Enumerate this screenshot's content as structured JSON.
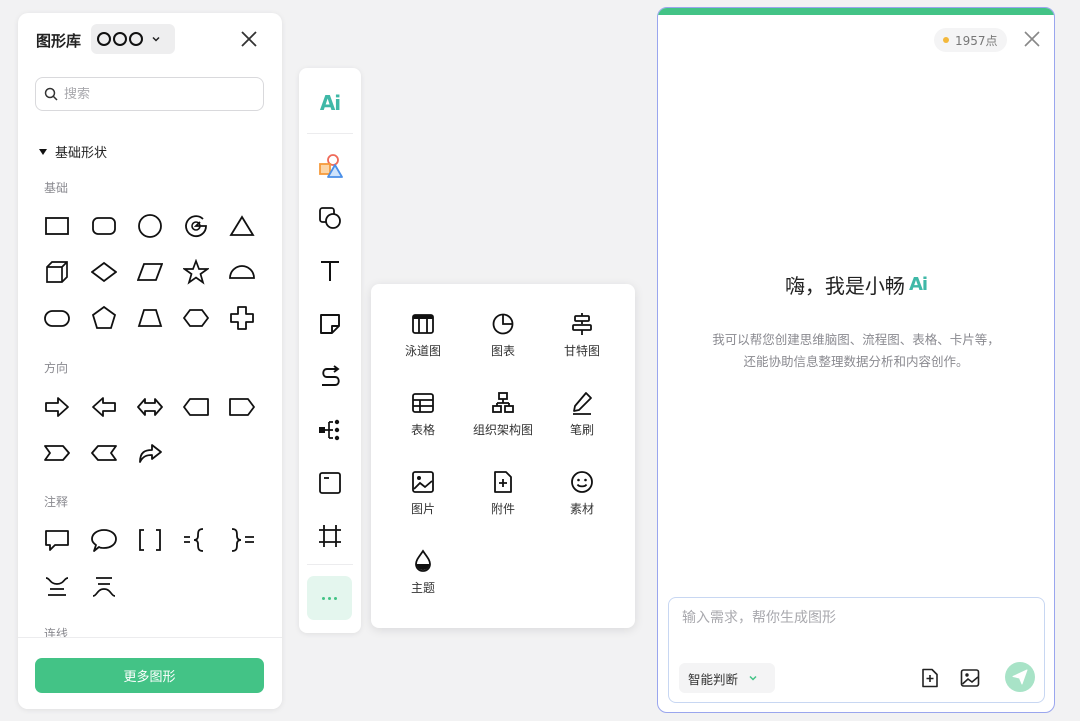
{
  "shape_library": {
    "title": "图形库",
    "close_icon": "close-icon",
    "search": {
      "placeholder": "搜索",
      "value": ""
    },
    "section": "基础形状",
    "groups": {
      "basic": "基础",
      "direction": "方向",
      "annotation": "注释",
      "next_partial": "连线"
    },
    "more_button": "更多图形"
  },
  "toolbar": {
    "items": [
      "ai-icon",
      "shapes-icon",
      "shape-insert-icon",
      "text-icon",
      "sticky-note-icon",
      "connector-icon",
      "mindmap-icon",
      "frame-icon",
      "crop-frame-icon",
      "more-icon"
    ]
  },
  "popup": {
    "items": [
      {
        "label": "泳道图",
        "icon": "swimlane-icon"
      },
      {
        "label": "图表",
        "icon": "pie-chart-icon"
      },
      {
        "label": "甘特图",
        "icon": "gantt-icon"
      },
      {
        "label": "表格",
        "icon": "table-icon"
      },
      {
        "label": "组织架构图",
        "icon": "org-chart-icon"
      },
      {
        "label": "笔刷",
        "icon": "brush-icon"
      },
      {
        "label": "图片",
        "icon": "image-icon"
      },
      {
        "label": "附件",
        "icon": "attachment-icon"
      },
      {
        "label": "素材",
        "icon": "smiley-icon"
      },
      {
        "label": "主题",
        "icon": "theme-drop-icon"
      }
    ]
  },
  "ai_panel": {
    "points": "1957点",
    "greeting": "嗨，我是小畅",
    "ai_badge": "Ai",
    "description_line1": "我可以帮您创建思维脑图、流程图、表格、卡片等，",
    "description_line2": "还能协助信息整理数据分析和内容创作。",
    "input": {
      "placeholder": "输入需求，帮你生成图形",
      "value": ""
    },
    "mode": "智能判断"
  },
  "colors": {
    "accent": "#43c386",
    "ai_gradient": "#3fb8a7",
    "points_dot": "#f3b83b"
  }
}
